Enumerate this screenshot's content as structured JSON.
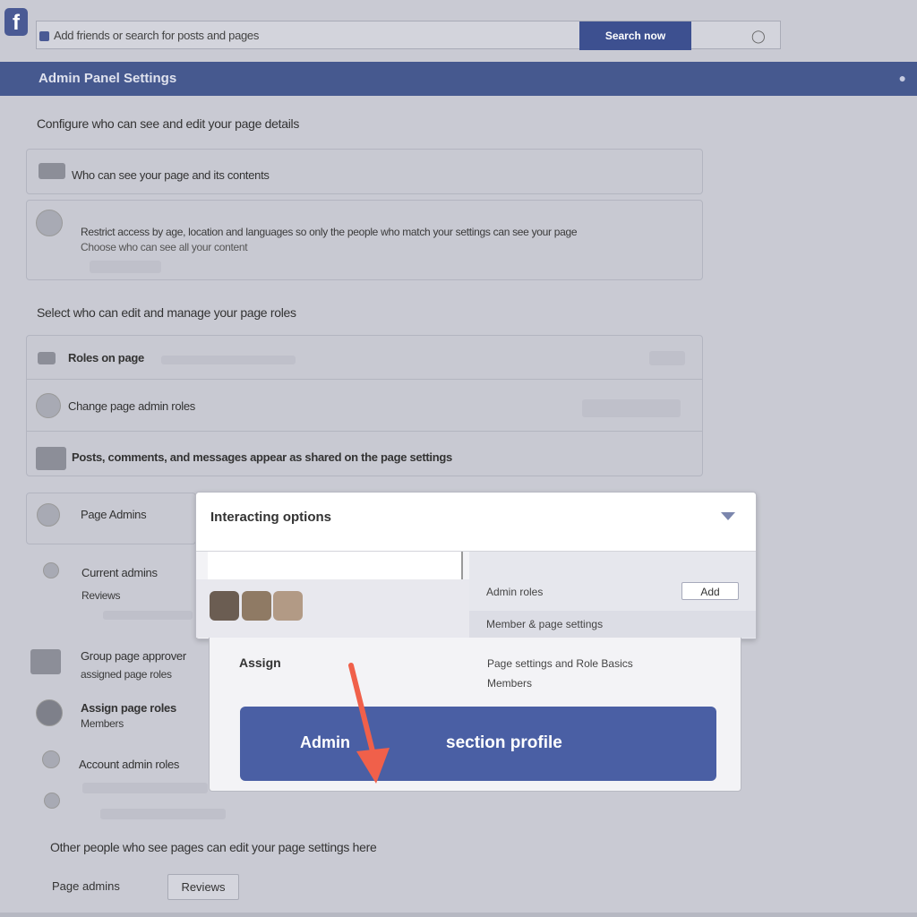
{
  "topbar": {
    "logo": "f",
    "search_text": "Add friends or search for posts and pages",
    "search_button": "Search now",
    "bulb_icon": "bulb-icon"
  },
  "header": {
    "title": "Admin Panel Settings"
  },
  "section1": {
    "heading": "Configure who can see and edit your page details",
    "row1_label": "Who can see your page and its contents",
    "row2_line1": "Restrict access by age, location and languages so only the people who match your settings can see your page",
    "row2_line2": "Choose who can see all your content"
  },
  "section2": {
    "heading": "Select who can edit and manage your page roles",
    "row1_label": "Roles on page",
    "row2_label": "Change page admin roles",
    "row3_label": "Posts, comments, and messages appear as shared on the page settings",
    "row4_label": "Page Admins",
    "row5_label": "Current admins",
    "row5_sub": "Reviews",
    "row6_label": "Group page approver",
    "row6_sub": "assigned page roles",
    "row7_label": "Assign page roles",
    "row7_sub": "Members",
    "row8_label": "Account admin roles"
  },
  "modal": {
    "title": "Interacting options",
    "right_label": "Admin roles",
    "right_button": "Add",
    "right_row2": "Member & page settings",
    "panel_left_title": "Assign",
    "panel_right_line1": "Page settings and Role Basics",
    "panel_right_line2": "Members",
    "button_left": "Admin",
    "button_right": "section profile"
  },
  "footer": {
    "text": "Other people who see pages can edit your page settings here",
    "label": "Page admins",
    "button": "Reviews"
  },
  "colors": {
    "brand": "#46598f",
    "button": "#4a5fa4",
    "arrow": "#f0604a"
  }
}
